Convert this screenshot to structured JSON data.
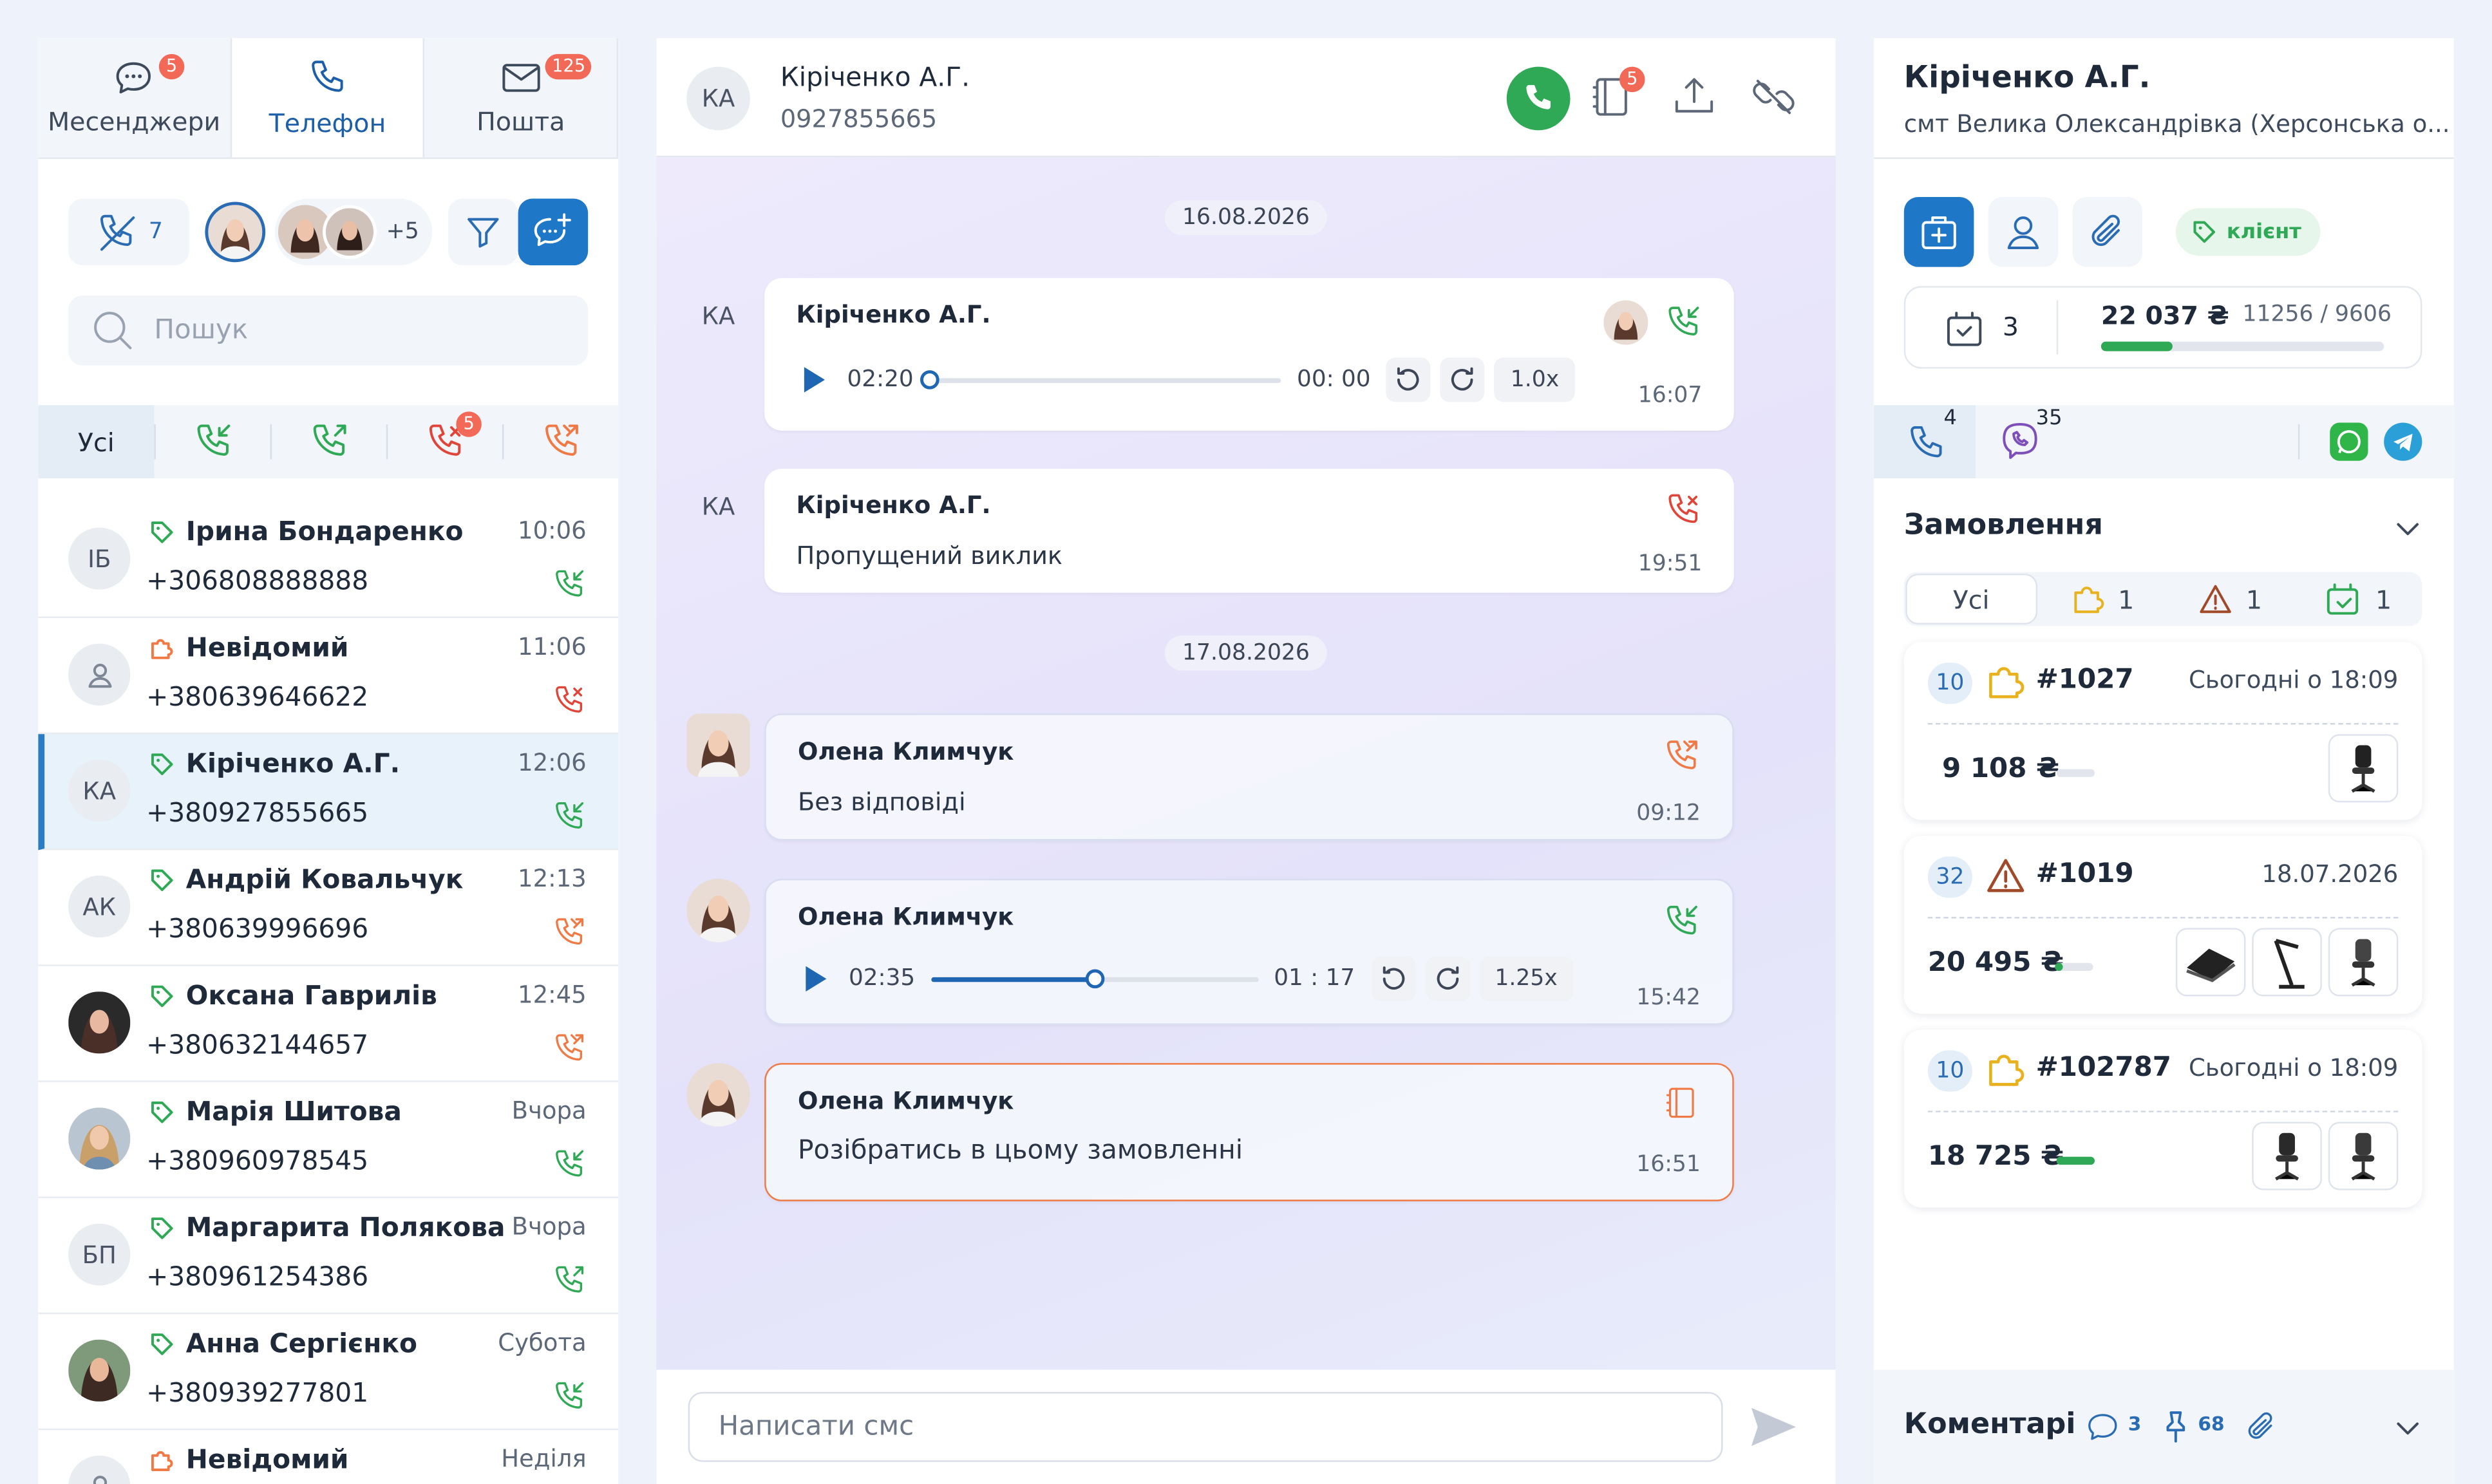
{
  "left": {
    "tabs": [
      {
        "label": "Месенджери",
        "badge": "5",
        "icon": "chat-icon"
      },
      {
        "label": "Телефон",
        "badge": "",
        "icon": "phone-icon"
      },
      {
        "label": "Пошта",
        "badge": "125",
        "icon": "mail-icon"
      }
    ],
    "missed_count": "7",
    "agents_more": "+5",
    "search_placeholder": "Пошук",
    "filters": {
      "all": "Усі",
      "missed_badge": "5"
    },
    "contacts": [
      {
        "initials": "ІБ",
        "name": "Ірина Бондаренко",
        "phone": "+306808888888",
        "time": "10:06",
        "tag": "green",
        "call": "incoming"
      },
      {
        "initials": "",
        "name": "Невідомий",
        "phone": "+380639646622",
        "time": "11:06",
        "tag": "orange",
        "call": "missed"
      },
      {
        "initials": "КА",
        "name": "Кіріченко А.Г.",
        "phone": "+380927855665",
        "time": "12:06",
        "tag": "green",
        "call": "incoming"
      },
      {
        "initials": "АК",
        "name": "Андрій Ковальчук",
        "phone": "+380639996696",
        "time": "12:13",
        "tag": "green",
        "call": "outgoing-failed"
      },
      {
        "initials": "",
        "name": "Оксана Гаврилів",
        "phone": "+380632144657",
        "time": "12:45",
        "tag": "green",
        "call": "outgoing-failed"
      },
      {
        "initials": "",
        "name": "Марія Шитова",
        "phone": "+380960978545",
        "time": "Вчора",
        "tag": "green",
        "call": "incoming"
      },
      {
        "initials": "БП",
        "name": "Маргарита Полякова",
        "phone": "+380961254386",
        "time": "Вчора",
        "tag": "green",
        "call": "outgoing"
      },
      {
        "initials": "",
        "name": "Анна Сергієнко",
        "phone": "+380939277801",
        "time": "Субота",
        "tag": "green",
        "call": "incoming"
      },
      {
        "initials": "",
        "name": "Невідомий",
        "phone": "",
        "time": "Неділя",
        "tag": "orange",
        "call": ""
      }
    ]
  },
  "chat": {
    "header": {
      "initials": "КА",
      "name": "Кіріченко А.Г.",
      "phone": "0927855665",
      "notes_badge": "5"
    },
    "date1": "16.08.2026",
    "date2": "17.08.2026",
    "messages": [
      {
        "sender": "Кіріченко А.Г.",
        "initials": "КА",
        "duration": "02:20",
        "position": "00: 00",
        "speed": "1.0x",
        "time": "16:07",
        "progress": 0
      },
      {
        "sender": "Кіріченко А.Г.",
        "initials": "КА",
        "text": "Пропущений виклик",
        "time": "19:51"
      },
      {
        "sender": "Олена Климчук",
        "text": "Без відповіді",
        "time": "09:12"
      },
      {
        "sender": "Олена Климчук",
        "duration": "02:35",
        "position": "01 : 17",
        "speed": "1.25x",
        "time": "15:42",
        "progress": 0.5
      },
      {
        "sender": "Олена Климчук",
        "text": "Розібратись в цьому замовленні",
        "time": "16:51"
      }
    ],
    "compose_placeholder": "Написати смс"
  },
  "right": {
    "name": "Кіріченко А.Г.",
    "location": "смт Велика Олександрівка (Херсонська о...",
    "client_tag": "клієнт",
    "stats": {
      "orders": "3",
      "sum": "22 037 ₴",
      "ratio": "11256 / 9606",
      "progress": 0.25
    },
    "channels": {
      "calls": "4",
      "viber": "35"
    },
    "orders_title": "Замовлення",
    "order_tabs": {
      "all": "Усі",
      "new": "1",
      "problem": "1",
      "done": "1"
    },
    "orders": [
      {
        "num": "10",
        "id": "#1027",
        "date": "Сьогодні о 18:09",
        "sum": "9 108 ₴",
        "progress": 0
      },
      {
        "num": "32",
        "id": "#1019",
        "date": "18.07.2026",
        "sum": "20 495 ₴",
        "progress": 0.1
      },
      {
        "num": "10",
        "id": "#102787",
        "date": "Сьогодні о 18:09",
        "sum": "18 725 ₴",
        "progress": 1
      }
    ],
    "comments_title": "Коментарі",
    "comments": {
      "messages": "3",
      "pins": "68"
    }
  },
  "colors": {
    "accent": "#1f77c8",
    "green": "#2fa955",
    "red": "#e0453a",
    "orange": "#f07a45"
  }
}
